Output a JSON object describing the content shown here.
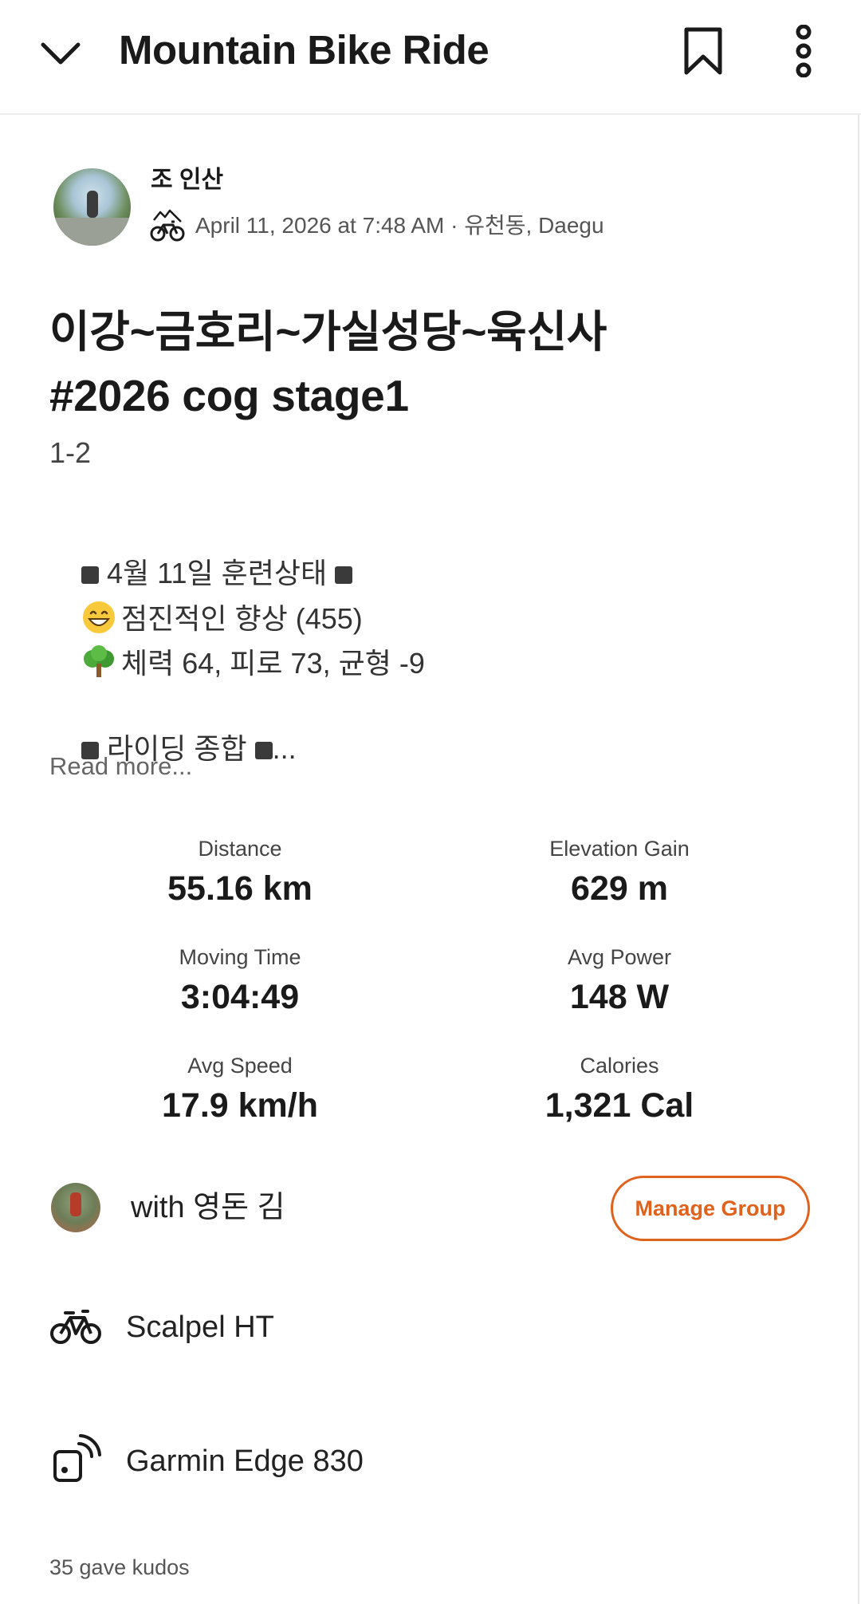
{
  "header": {
    "title": "Mountain Bike Ride"
  },
  "author": {
    "name": "조 인산",
    "meta": "April 11, 2026 at 7:48 AM · 유천동, Daegu"
  },
  "activity": {
    "title": "이강~금호리~가실성당~육신사\n#2026 cog stage1",
    "subtitle": "1-2",
    "description": {
      "line1": " 4월 11일 훈련상태 ",
      "line2": "점진적인 향상 (455)",
      "line3": "체력 64, 피로 73, 균형 -9",
      "line4": " 라이딩 종합 ",
      "line4_suffix": "..."
    },
    "read_more": "Read more..."
  },
  "stats": {
    "distance": {
      "label": "Distance",
      "value": "55.16 km"
    },
    "elevation": {
      "label": "Elevation Gain",
      "value": "629 m"
    },
    "moving_time": {
      "label": "Moving Time",
      "value": "3:04:49"
    },
    "avg_power": {
      "label": "Avg Power",
      "value": "148 W"
    },
    "avg_speed": {
      "label": "Avg Speed",
      "value": "17.9 km/h"
    },
    "calories": {
      "label": "Calories",
      "value": "1,321 Cal"
    }
  },
  "group": {
    "with_text": "with 영돈 김",
    "manage_label": "Manage Group"
  },
  "gear": {
    "bike": "Scalpel HT",
    "device": "Garmin Edge 830"
  },
  "kudos": "35 gave kudos",
  "colors": {
    "accent": "#e0621d",
    "text": "#1a1a1a",
    "muted": "#555555"
  },
  "icons": {
    "back": "chevron-down-icon",
    "bookmark": "bookmark-icon",
    "more": "more-vertical-icon",
    "activity_type": "mountain-bike-icon",
    "bike": "bicycle-icon",
    "device": "device-signal-icon"
  }
}
